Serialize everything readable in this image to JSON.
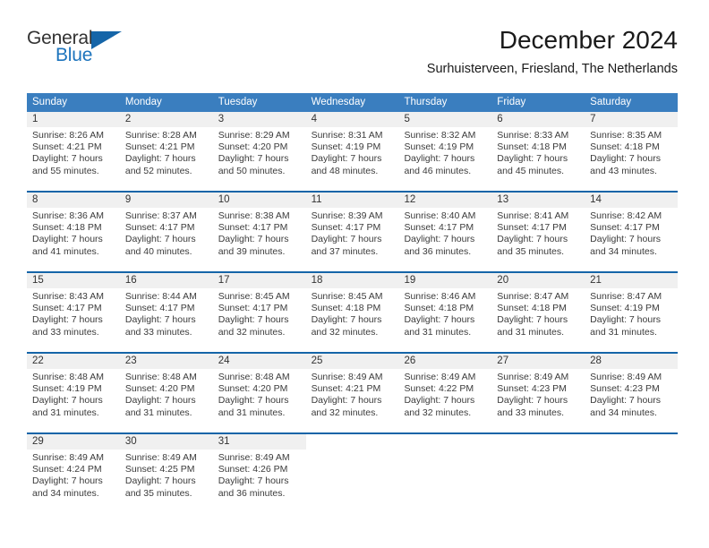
{
  "brand": {
    "line1": "General",
    "line2": "Blue",
    "flag_icon": "blue-triangle-flag-icon",
    "accent_color": "#1565a8",
    "text_color": "#1d74bd"
  },
  "header": {
    "title": "December 2024",
    "subtitle": "Surhuisterveen, Friesland, The Netherlands"
  },
  "theme": {
    "header_bg": "#3a7ebf",
    "week_divider": "#1565a8",
    "day_number_bg": "#f0f0f0"
  },
  "weekdays": [
    "Sunday",
    "Monday",
    "Tuesday",
    "Wednesday",
    "Thursday",
    "Friday",
    "Saturday"
  ],
  "weeks": [
    [
      {
        "day": "1",
        "sunrise": "Sunrise: 8:26 AM",
        "sunset": "Sunset: 4:21 PM",
        "daylight1": "Daylight: 7 hours",
        "daylight2": "and 55 minutes."
      },
      {
        "day": "2",
        "sunrise": "Sunrise: 8:28 AM",
        "sunset": "Sunset: 4:21 PM",
        "daylight1": "Daylight: 7 hours",
        "daylight2": "and 52 minutes."
      },
      {
        "day": "3",
        "sunrise": "Sunrise: 8:29 AM",
        "sunset": "Sunset: 4:20 PM",
        "daylight1": "Daylight: 7 hours",
        "daylight2": "and 50 minutes."
      },
      {
        "day": "4",
        "sunrise": "Sunrise: 8:31 AM",
        "sunset": "Sunset: 4:19 PM",
        "daylight1": "Daylight: 7 hours",
        "daylight2": "and 48 minutes."
      },
      {
        "day": "5",
        "sunrise": "Sunrise: 8:32 AM",
        "sunset": "Sunset: 4:19 PM",
        "daylight1": "Daylight: 7 hours",
        "daylight2": "and 46 minutes."
      },
      {
        "day": "6",
        "sunrise": "Sunrise: 8:33 AM",
        "sunset": "Sunset: 4:18 PM",
        "daylight1": "Daylight: 7 hours",
        "daylight2": "and 45 minutes."
      },
      {
        "day": "7",
        "sunrise": "Sunrise: 8:35 AM",
        "sunset": "Sunset: 4:18 PM",
        "daylight1": "Daylight: 7 hours",
        "daylight2": "and 43 minutes."
      }
    ],
    [
      {
        "day": "8",
        "sunrise": "Sunrise: 8:36 AM",
        "sunset": "Sunset: 4:18 PM",
        "daylight1": "Daylight: 7 hours",
        "daylight2": "and 41 minutes."
      },
      {
        "day": "9",
        "sunrise": "Sunrise: 8:37 AM",
        "sunset": "Sunset: 4:17 PM",
        "daylight1": "Daylight: 7 hours",
        "daylight2": "and 40 minutes."
      },
      {
        "day": "10",
        "sunrise": "Sunrise: 8:38 AM",
        "sunset": "Sunset: 4:17 PM",
        "daylight1": "Daylight: 7 hours",
        "daylight2": "and 39 minutes."
      },
      {
        "day": "11",
        "sunrise": "Sunrise: 8:39 AM",
        "sunset": "Sunset: 4:17 PM",
        "daylight1": "Daylight: 7 hours",
        "daylight2": "and 37 minutes."
      },
      {
        "day": "12",
        "sunrise": "Sunrise: 8:40 AM",
        "sunset": "Sunset: 4:17 PM",
        "daylight1": "Daylight: 7 hours",
        "daylight2": "and 36 minutes."
      },
      {
        "day": "13",
        "sunrise": "Sunrise: 8:41 AM",
        "sunset": "Sunset: 4:17 PM",
        "daylight1": "Daylight: 7 hours",
        "daylight2": "and 35 minutes."
      },
      {
        "day": "14",
        "sunrise": "Sunrise: 8:42 AM",
        "sunset": "Sunset: 4:17 PM",
        "daylight1": "Daylight: 7 hours",
        "daylight2": "and 34 minutes."
      }
    ],
    [
      {
        "day": "15",
        "sunrise": "Sunrise: 8:43 AM",
        "sunset": "Sunset: 4:17 PM",
        "daylight1": "Daylight: 7 hours",
        "daylight2": "and 33 minutes."
      },
      {
        "day": "16",
        "sunrise": "Sunrise: 8:44 AM",
        "sunset": "Sunset: 4:17 PM",
        "daylight1": "Daylight: 7 hours",
        "daylight2": "and 33 minutes."
      },
      {
        "day": "17",
        "sunrise": "Sunrise: 8:45 AM",
        "sunset": "Sunset: 4:17 PM",
        "daylight1": "Daylight: 7 hours",
        "daylight2": "and 32 minutes."
      },
      {
        "day": "18",
        "sunrise": "Sunrise: 8:45 AM",
        "sunset": "Sunset: 4:18 PM",
        "daylight1": "Daylight: 7 hours",
        "daylight2": "and 32 minutes."
      },
      {
        "day": "19",
        "sunrise": "Sunrise: 8:46 AM",
        "sunset": "Sunset: 4:18 PM",
        "daylight1": "Daylight: 7 hours",
        "daylight2": "and 31 minutes."
      },
      {
        "day": "20",
        "sunrise": "Sunrise: 8:47 AM",
        "sunset": "Sunset: 4:18 PM",
        "daylight1": "Daylight: 7 hours",
        "daylight2": "and 31 minutes."
      },
      {
        "day": "21",
        "sunrise": "Sunrise: 8:47 AM",
        "sunset": "Sunset: 4:19 PM",
        "daylight1": "Daylight: 7 hours",
        "daylight2": "and 31 minutes."
      }
    ],
    [
      {
        "day": "22",
        "sunrise": "Sunrise: 8:48 AM",
        "sunset": "Sunset: 4:19 PM",
        "daylight1": "Daylight: 7 hours",
        "daylight2": "and 31 minutes."
      },
      {
        "day": "23",
        "sunrise": "Sunrise: 8:48 AM",
        "sunset": "Sunset: 4:20 PM",
        "daylight1": "Daylight: 7 hours",
        "daylight2": "and 31 minutes."
      },
      {
        "day": "24",
        "sunrise": "Sunrise: 8:48 AM",
        "sunset": "Sunset: 4:20 PM",
        "daylight1": "Daylight: 7 hours",
        "daylight2": "and 31 minutes."
      },
      {
        "day": "25",
        "sunrise": "Sunrise: 8:49 AM",
        "sunset": "Sunset: 4:21 PM",
        "daylight1": "Daylight: 7 hours",
        "daylight2": "and 32 minutes."
      },
      {
        "day": "26",
        "sunrise": "Sunrise: 8:49 AM",
        "sunset": "Sunset: 4:22 PM",
        "daylight1": "Daylight: 7 hours",
        "daylight2": "and 32 minutes."
      },
      {
        "day": "27",
        "sunrise": "Sunrise: 8:49 AM",
        "sunset": "Sunset: 4:23 PM",
        "daylight1": "Daylight: 7 hours",
        "daylight2": "and 33 minutes."
      },
      {
        "day": "28",
        "sunrise": "Sunrise: 8:49 AM",
        "sunset": "Sunset: 4:23 PM",
        "daylight1": "Daylight: 7 hours",
        "daylight2": "and 34 minutes."
      }
    ],
    [
      {
        "day": "29",
        "sunrise": "Sunrise: 8:49 AM",
        "sunset": "Sunset: 4:24 PM",
        "daylight1": "Daylight: 7 hours",
        "daylight2": "and 34 minutes."
      },
      {
        "day": "30",
        "sunrise": "Sunrise: 8:49 AM",
        "sunset": "Sunset: 4:25 PM",
        "daylight1": "Daylight: 7 hours",
        "daylight2": "and 35 minutes."
      },
      {
        "day": "31",
        "sunrise": "Sunrise: 8:49 AM",
        "sunset": "Sunset: 4:26 PM",
        "daylight1": "Daylight: 7 hours",
        "daylight2": "and 36 minutes."
      },
      {
        "day": "",
        "sunrise": "",
        "sunset": "",
        "daylight1": "",
        "daylight2": ""
      },
      {
        "day": "",
        "sunrise": "",
        "sunset": "",
        "daylight1": "",
        "daylight2": ""
      },
      {
        "day": "",
        "sunrise": "",
        "sunset": "",
        "daylight1": "",
        "daylight2": ""
      },
      {
        "day": "",
        "sunrise": "",
        "sunset": "",
        "daylight1": "",
        "daylight2": ""
      }
    ]
  ]
}
